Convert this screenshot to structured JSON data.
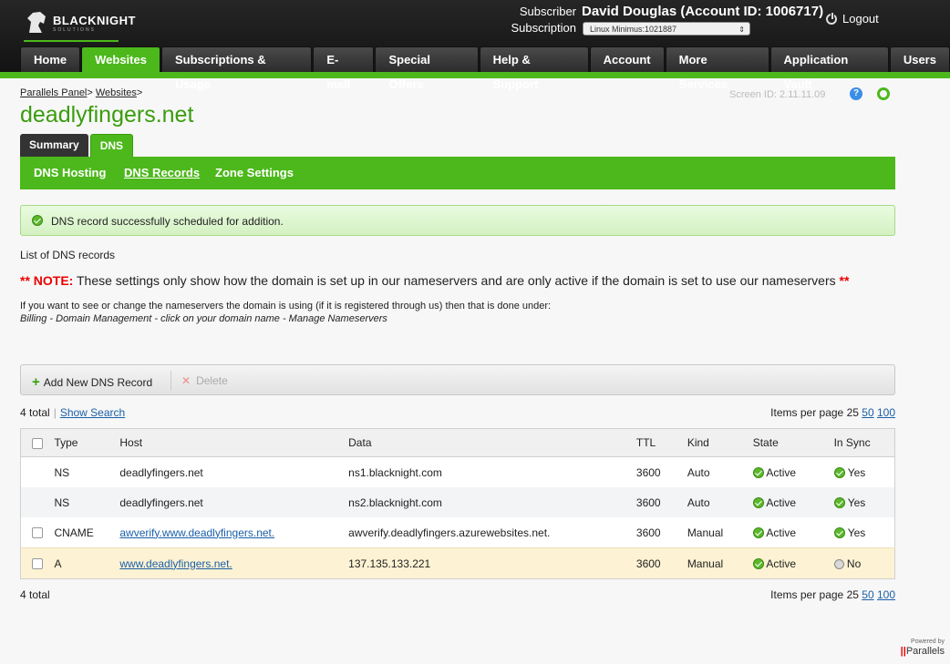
{
  "brand": {
    "name": "BLACKNIGHT",
    "sub": "SOLUTIONS"
  },
  "header": {
    "subscriber_label": "Subscriber",
    "subscriber_name": "David Douglas (Account ID: 1006717)",
    "subscription_label": "Subscription",
    "subscription_value": "Linux Minimus:1021887",
    "logout": "Logout"
  },
  "nav": [
    {
      "label": "Home",
      "active": false
    },
    {
      "label": "Websites",
      "active": true
    },
    {
      "label": "Subscriptions & Usage",
      "active": false
    },
    {
      "label": "E-mail",
      "active": false
    },
    {
      "label": "Special Offers",
      "active": false
    },
    {
      "label": "Help & Support",
      "active": false
    },
    {
      "label": "Account",
      "active": false
    },
    {
      "label": "More Services",
      "active": false
    },
    {
      "label": "Application Vault",
      "active": false
    },
    {
      "label": "Users",
      "active": false
    }
  ],
  "breadcrumb": [
    "Parallels Panel",
    "Websites"
  ],
  "screen_id": "Screen ID:  2.11.11.09",
  "page_title": "deadlyfingers.net",
  "tabs": [
    {
      "label": "Summary"
    },
    {
      "label": "DNS"
    }
  ],
  "subnav": [
    {
      "label": "DNS Hosting"
    },
    {
      "label": "DNS Records"
    },
    {
      "label": "Zone Settings"
    }
  ],
  "message": "DNS record successfully scheduled for addition.",
  "list_title": "List of DNS records",
  "note": {
    "prefix": "** NOTE:",
    "text": " These settings only show how the domain is set up in our nameservers and are only active if the domain is set to use our nameservers ",
    "suffix": "**"
  },
  "info_line": "If you want to see or change the nameservers the domain is using (if it is registered through us) then that is done under:",
  "info_path": "Billing - Domain Management - click on your domain name - Manage Nameservers",
  "toolbar": {
    "add": "Add New DNS Record",
    "delete": "Delete"
  },
  "pager": {
    "total": "4 total",
    "show_search": "Show Search",
    "items_per_page": "Items per page",
    "current": "25",
    "opt1": "50",
    "opt2": "100"
  },
  "table": {
    "headers": {
      "type": "Type",
      "host": "Host",
      "data": "Data",
      "ttl": "TTL",
      "kind": "Kind",
      "state": "State",
      "sync": "In Sync"
    },
    "rows": [
      {
        "type": "NS",
        "host": "deadlyfingers.net",
        "data": "ns1.blacknight.com",
        "ttl": "3600",
        "kind": "Auto",
        "state": "Active",
        "sync": "Yes"
      },
      {
        "type": "NS",
        "host": "deadlyfingers.net",
        "data": "ns2.blacknight.com",
        "ttl": "3600",
        "kind": "Auto",
        "state": "Active",
        "sync": "Yes"
      },
      {
        "type": "CNAME",
        "host": "awverify.www.deadlyfingers.net.",
        "data": "awverify.deadlyfingers.azurewebsites.net.",
        "ttl": "3600",
        "kind": "Manual",
        "state": "Active",
        "sync": "Yes"
      },
      {
        "type": "A",
        "host": "www.deadlyfingers.net.",
        "data": "137.135.133.221",
        "ttl": "3600",
        "kind": "Manual",
        "state": "Active",
        "sync": "No"
      }
    ]
  },
  "footer": {
    "powered": "Powered by",
    "parallels": "Parallels"
  }
}
